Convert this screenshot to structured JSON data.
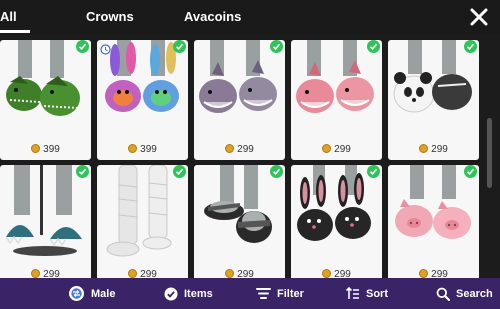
{
  "tabs": [
    {
      "label": "All",
      "active": true
    },
    {
      "label": "Crowns",
      "active": false
    },
    {
      "label": "Avacoins",
      "active": false
    }
  ],
  "items": [
    {
      "name": "dinosaur-slippers",
      "price": "399",
      "owned": true,
      "timed": false
    },
    {
      "name": "rainbow-bunny-slippers",
      "price": "399",
      "owned": true,
      "timed": true
    },
    {
      "name": "grey-shark-slippers",
      "price": "299",
      "owned": true,
      "timed": false
    },
    {
      "name": "pink-shark-slippers",
      "price": "299",
      "owned": true,
      "timed": false
    },
    {
      "name": "panda-slippers",
      "price": "299",
      "owned": true,
      "timed": false
    },
    {
      "name": "monster-claw-slippers",
      "price": "299",
      "owned": true,
      "timed": false
    },
    {
      "name": "white-slouch-socks",
      "price": "299",
      "owned": true,
      "timed": false
    },
    {
      "name": "black-slide-sandals",
      "price": "299",
      "owned": true,
      "timed": false
    },
    {
      "name": "black-bunny-slippers",
      "price": "299",
      "owned": true,
      "timed": false
    },
    {
      "name": "pink-pig-slippers",
      "price": "299",
      "owned": true,
      "timed": false
    }
  ],
  "bottom_bar": {
    "gender_label": "Male",
    "items_label": "Items",
    "filter_label": "Filter",
    "sort_label": "Sort",
    "search_label": "Search"
  },
  "colors": {
    "owned_check": "#2ec45a",
    "coin": "#e0a020",
    "bottom_bar": "#3a2366"
  }
}
